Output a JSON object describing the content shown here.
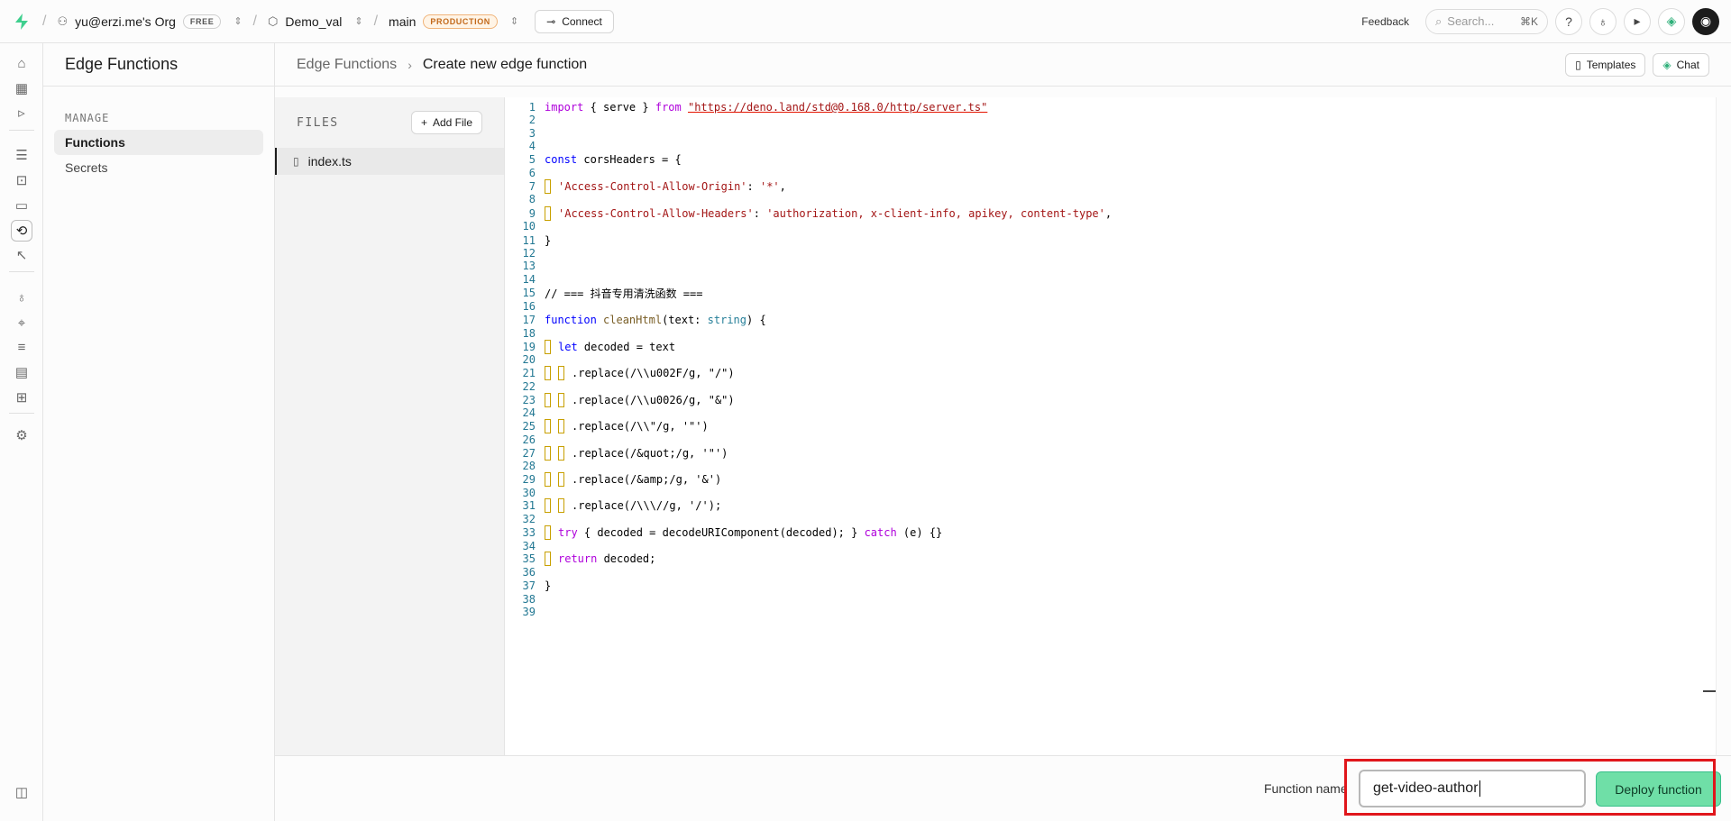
{
  "topbar": {
    "org": "yu@erzi.me's Org",
    "org_badge": "FREE",
    "project": "Demo_val",
    "branch": "main",
    "branch_badge": "PRODUCTION",
    "connect": "Connect",
    "feedback": "Feedback",
    "search_placeholder": "Search...",
    "search_shortcut": "⌘K"
  },
  "menu": {
    "title": "Edge Functions",
    "group": "MANAGE",
    "items": [
      {
        "label": "Functions",
        "active": true
      },
      {
        "label": "Secrets",
        "active": false
      }
    ]
  },
  "header": {
    "breadcrumb_root": "Edge Functions",
    "breadcrumb_current": "Create new edge function",
    "templates": "Templates",
    "chat": "Chat"
  },
  "files": {
    "label": "FILES",
    "add_file": "Add File",
    "items": [
      "index.ts"
    ]
  },
  "editor": {
    "lines": [
      {
        "n": "1"
      },
      {
        "n": "2"
      },
      {
        "n": "3"
      },
      {
        "n": "4"
      },
      {
        "n": "5"
      },
      {
        "n": "6"
      },
      {
        "n": "7"
      },
      {
        "n": "8"
      },
      {
        "n": "9"
      },
      {
        "n": "10"
      },
      {
        "n": "11"
      },
      {
        "n": "12"
      },
      {
        "n": "13"
      },
      {
        "n": "14"
      },
      {
        "n": "15"
      },
      {
        "n": "16"
      },
      {
        "n": "17"
      },
      {
        "n": "18"
      },
      {
        "n": "19"
      },
      {
        "n": "20"
      },
      {
        "n": "21"
      },
      {
        "n": "22"
      },
      {
        "n": "23"
      },
      {
        "n": "24"
      },
      {
        "n": "25"
      },
      {
        "n": "26"
      },
      {
        "n": "27"
      },
      {
        "n": "28"
      },
      {
        "n": "29"
      },
      {
        "n": "30"
      },
      {
        "n": "31"
      },
      {
        "n": "32"
      },
      {
        "n": "33"
      },
      {
        "n": "34"
      },
      {
        "n": "35"
      },
      {
        "n": "36"
      },
      {
        "n": "37"
      },
      {
        "n": "38"
      },
      {
        "n": "39"
      }
    ],
    "code": {
      "l1_import": "import",
      "l1_brace": " { serve } ",
      "l1_from": "from",
      "l1_url": "\"https://deno.land/std@0.168.0/http/server.ts\"",
      "l5_const": "const",
      "l5_rest": " corsHeaders = {",
      "l7_key": "'Access-Control-Allow-Origin'",
      "l7_val": "'*'",
      "l9_key": "'Access-Control-Allow-Headers'",
      "l9_val": "'authorization, x-client-info, apikey, content-type'",
      "l11": "}",
      "l15": "// === 抖音专用清洗函数 ===",
      "l17_function": "function",
      "l17_name": "cleanHtml",
      "l17_param": "(text: ",
      "l17_type": "string",
      "l17_end": ") {",
      "l19_let": "let",
      "l19_rest": " decoded = text",
      "l21": ".replace(/\\\\u002F/g, \"/\")",
      "l23": ".replace(/\\\\u0026/g, \"&\")",
      "l25": ".replace(/\\\\\"/g, '\"')",
      "l27": ".replace(/&quot;/g, '\"')",
      "l29": ".replace(/&amp;/g, '&')",
      "l31": ".replace(/\\\\\\//g, '/');",
      "l33_try": "try",
      "l33_rest": " { decoded = decodeURIComponent(decoded); } ",
      "l33_catch": "catch",
      "l33_end": " (e) {}",
      "l35_return": "return",
      "l35_rest": " decoded;",
      "l37": "}"
    }
  },
  "footer": {
    "function_name_label": "Function name",
    "function_name_value": "get-video-author",
    "deploy": "Deploy function"
  }
}
